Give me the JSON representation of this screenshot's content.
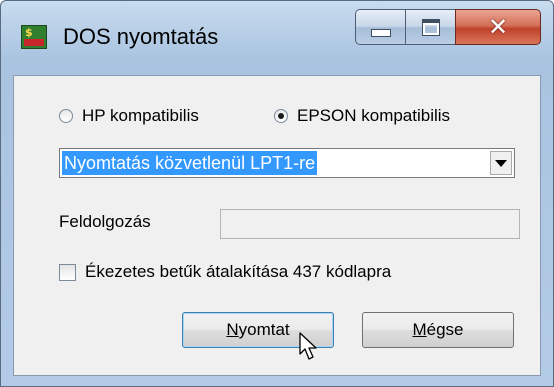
{
  "window": {
    "title": "DOS nyomtatás",
    "controls": {
      "minimize": "minimize-icon",
      "maximize": "maximize-icon",
      "close": "close-icon"
    }
  },
  "printer_type": {
    "options": [
      {
        "label": "HP kompatibilis",
        "checked": false
      },
      {
        "label": "EPSON kompatibilis",
        "checked": true
      }
    ]
  },
  "output_select": {
    "selected": "Nyomtatás közvetlenül LPT1-re",
    "selected_highlight": "#3399ff"
  },
  "processing": {
    "label": "Feldolgozás",
    "progress": 0
  },
  "convert_option": {
    "label": "Ékezetes betűk átalakítása 437 kódlapra",
    "checked": false
  },
  "buttons": {
    "print_label": "Nyomtat",
    "cancel_label": "Mégse"
  }
}
